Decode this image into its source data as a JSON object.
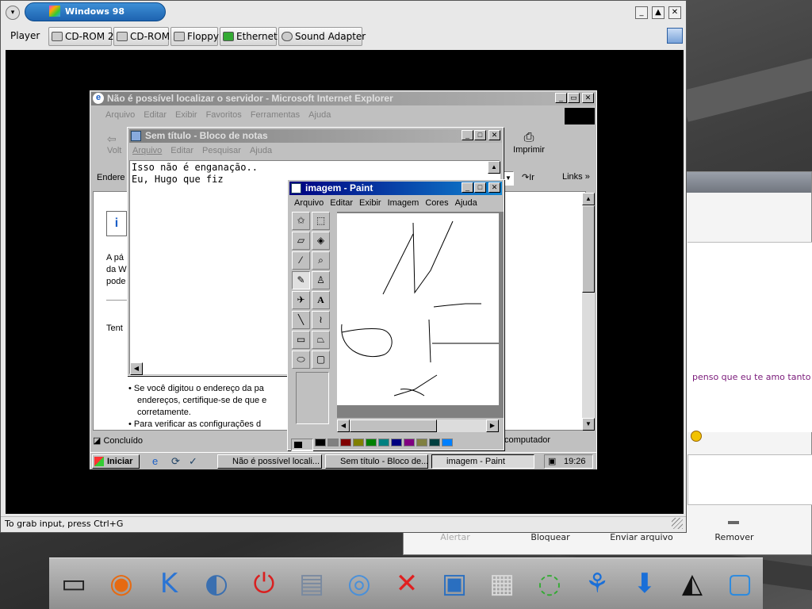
{
  "host": {
    "chat_message": "penso que eu te amo tanto",
    "chat_actions": [
      "Alertar",
      "Bloquear",
      "Enviar arquivo",
      "Remover"
    ]
  },
  "player": {
    "title": "Windows 98",
    "menu_label": "Player",
    "devices": [
      "CD-ROM 2",
      "CD-ROM",
      "Floppy",
      "Ethernet",
      "Sound Adapter"
    ],
    "status": "To grab input, press Ctrl+G"
  },
  "ie": {
    "title": "Não é possível localizar o servidor - Microsoft Internet Explorer",
    "menu": [
      "Arquivo",
      "Editar",
      "Exibir",
      "Favoritos",
      "Ferramentas",
      "Ajuda"
    ],
    "toolbar_print": "Imprimir",
    "back_label": "Volt",
    "address_label": "Endere",
    "go_label": "Ir",
    "links_label": "Links",
    "body_lines": [
      "A pá",
      "da W",
      "pode"
    ],
    "try_text": "Tent",
    "bullets": [
      "Se você digitou o endereço da pa",
      "endereços, certifique-se de que e",
      "corretamente.",
      "Para verificar as configurações d"
    ],
    "status_left": "Concluído",
    "status_right": "computador"
  },
  "notepad": {
    "title": "Sem título - Bloco de notas",
    "menu": [
      "Arquivo",
      "Editar",
      "Pesquisar",
      "Ajuda"
    ],
    "line1": "Isso não é enganação..",
    "line2": "Eu, Hugo que fiz"
  },
  "paint": {
    "title": "imagem - Paint",
    "menu": [
      "Arquivo",
      "Editar",
      "Exibir",
      "Imagem",
      "Cores",
      "Ajuda"
    ],
    "palette": [
      "#000000",
      "#808080",
      "#800000",
      "#808000",
      "#008000",
      "#008080",
      "#000080",
      "#800080",
      "#808040",
      "#004040",
      "#0080ff",
      "#004080",
      "#8000ff",
      "#804000",
      "#ffffff",
      "#c0c0c0",
      "#ff0000",
      "#ffff00",
      "#00ff00",
      "#00ffff",
      "#0000ff",
      "#ff00ff"
    ]
  },
  "taskbar": {
    "start": "Iniciar",
    "tasks": [
      "Não é possível locali...",
      "Sem título - Bloco de...",
      "imagem - Paint"
    ],
    "clock": "19:26"
  },
  "dock": {
    "icons": [
      "terminal-icon",
      "firefox-icon",
      "kde-icon",
      "wolf-icon",
      "shutdown-icon",
      "drive-icon",
      "disc-icon",
      "x-icon",
      "network-monitor-icon",
      "calculator-icon",
      "wireless-icon",
      "runner-icon",
      "download-icon",
      "tux-icon",
      "display-icon"
    ]
  }
}
